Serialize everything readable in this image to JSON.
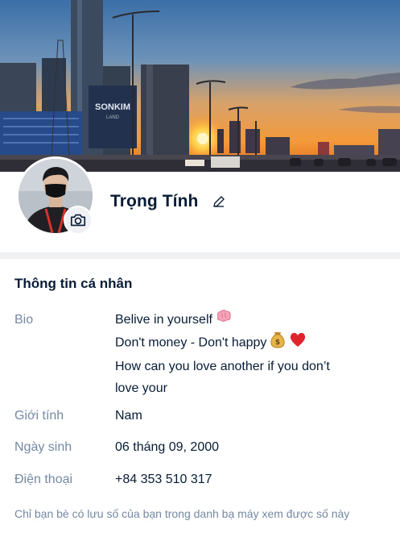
{
  "profile": {
    "name": "Trọng Tính",
    "cover_sign_text": "SONKIM",
    "cover_sign_subtext": "LAND"
  },
  "personal_info": {
    "section_title": "Thông tin cá nhân",
    "bio": {
      "label": "Bio",
      "lines": [
        "Belive in yourself",
        "Don't money - Don't happy",
        "How can you love another if you don’t",
        "love your"
      ]
    },
    "gender": {
      "label": "Giới tính",
      "value": "Nam"
    },
    "birthday": {
      "label": "Ngày sinh",
      "value": "06 tháng 09, 2000"
    },
    "phone": {
      "label": "Điện thoại",
      "value": "+84 353 510 317"
    },
    "privacy_note": "Chỉ bạn bè có lưu số của bạn trong danh bạ máy xem được số này"
  },
  "icons": {
    "camera": "camera-icon",
    "edit": "pencil-icon",
    "brain_emoji": "brain-emoji-icon",
    "money_bag_emoji": "money-bag-emoji-icon",
    "heart_emoji": "red-heart-emoji-icon"
  },
  "colors": {
    "primary_text": "#081c36",
    "secondary_text": "#7589a3",
    "divider": "#eef0f1"
  }
}
